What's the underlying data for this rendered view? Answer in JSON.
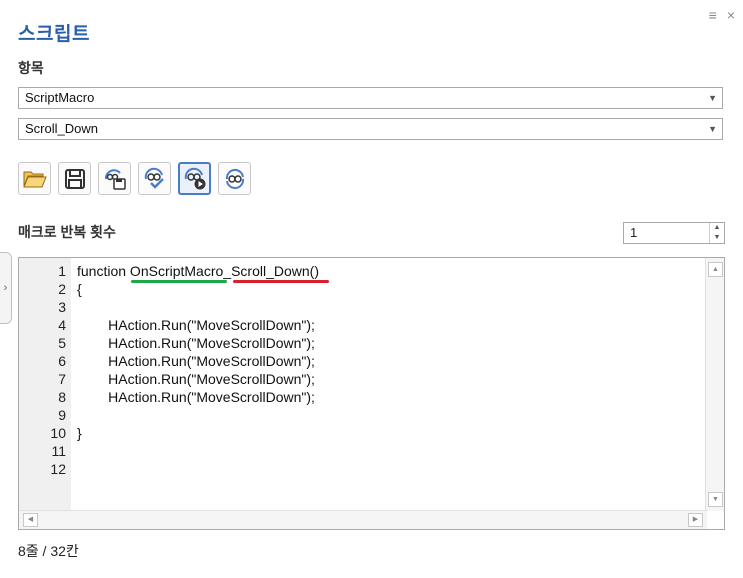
{
  "panel": {
    "title": "스크립트",
    "section_label": "항목",
    "menu_icon": "≡",
    "close_icon": "×"
  },
  "selects": {
    "category": "ScriptMacro",
    "macro": "Scroll_Down"
  },
  "toolbar": {
    "buttons": [
      {
        "name": "open-folder-icon"
      },
      {
        "name": "save-icon"
      },
      {
        "name": "macro-save-icon"
      },
      {
        "name": "macro-check-icon"
      },
      {
        "name": "macro-run-icon"
      },
      {
        "name": "macro-repeat-icon"
      }
    ],
    "active_index": 4
  },
  "repeat": {
    "label": "매크로 반복 횟수",
    "value": "1"
  },
  "editor": {
    "lines": [
      {
        "num": "1",
        "text": "function OnScriptMacro_Scroll_Down()"
      },
      {
        "num": "2",
        "text": "{"
      },
      {
        "num": "3",
        "text": ""
      },
      {
        "num": "4",
        "text": "        HAction.Run(\"MoveScrollDown\");"
      },
      {
        "num": "5",
        "text": "        HAction.Run(\"MoveScrollDown\");"
      },
      {
        "num": "6",
        "text": "        HAction.Run(\"MoveScrollDown\");"
      },
      {
        "num": "7",
        "text": "        HAction.Run(\"MoveScrollDown\");"
      },
      {
        "num": "8",
        "text": "        HAction.Run(\"MoveScrollDown\");"
      },
      {
        "num": "9",
        "text": ""
      },
      {
        "num": "10",
        "text": "}"
      },
      {
        "num": "11",
        "text": ""
      },
      {
        "num": "12",
        "text": ""
      }
    ],
    "highlight_colors": {
      "green": "#1fa84a",
      "red": "#d8202a"
    }
  },
  "status": {
    "text": "8줄 / 32칸"
  },
  "colors": {
    "title": "#2a5fa8",
    "active_button_border": "#4a7cc9"
  }
}
